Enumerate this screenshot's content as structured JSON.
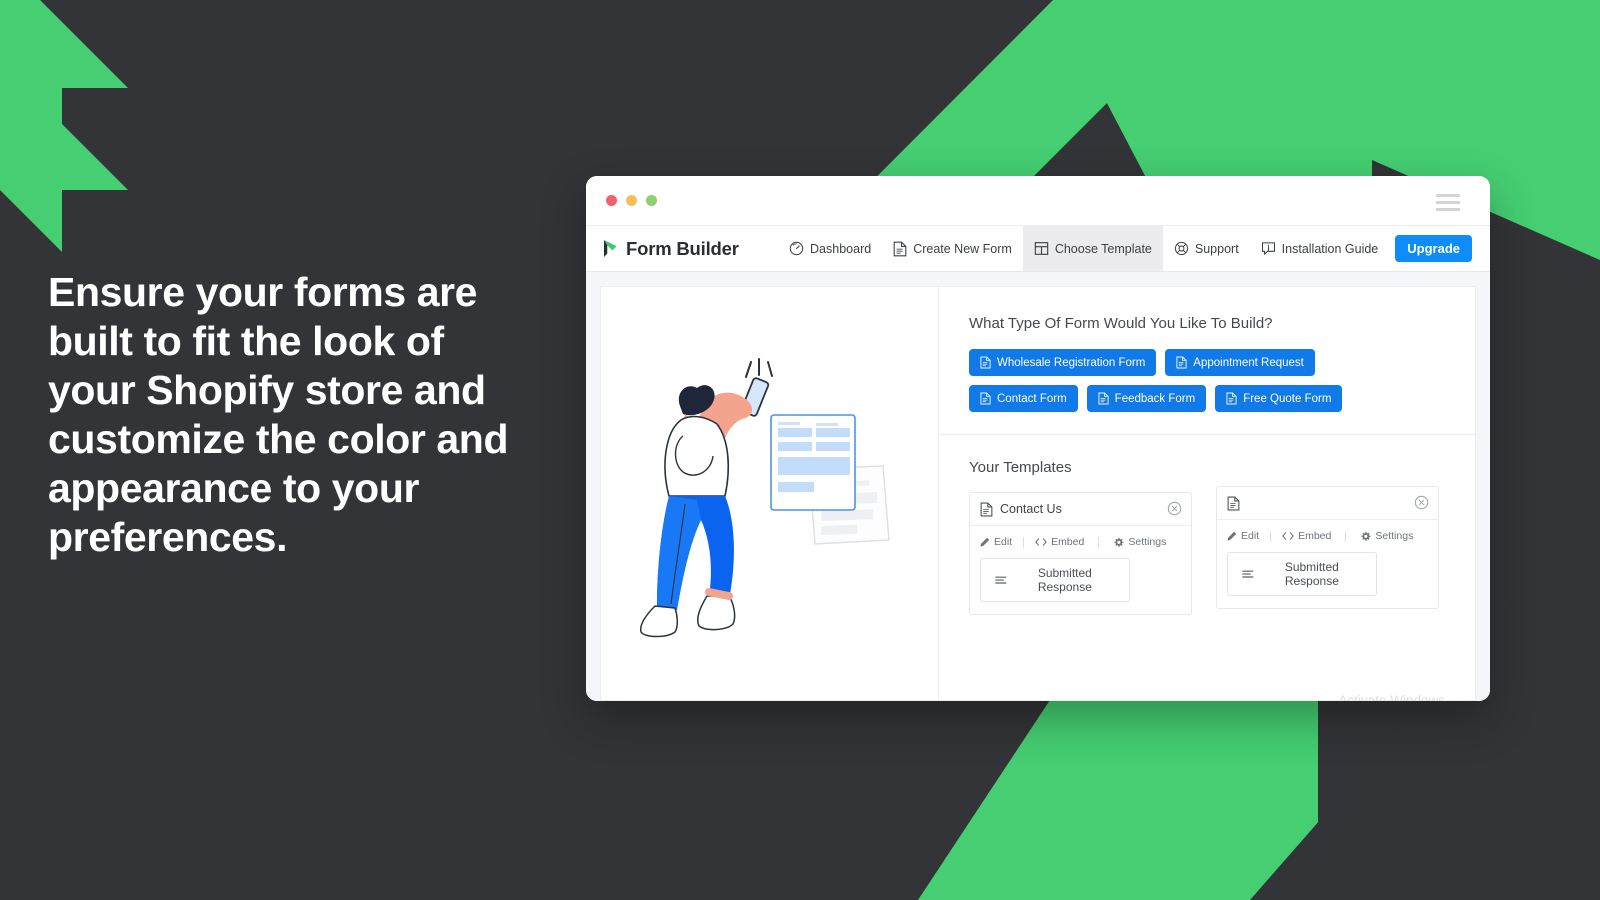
{
  "theme": {
    "background": "#333437",
    "accent_green": "#45CE72",
    "accent_blue": "#127AE8",
    "upgrade_blue": "#0E8CF7"
  },
  "headline": {
    "text": "Ensure your forms are built to fit the look of your Shopify store and customize the color and appearance to your preferences."
  },
  "browser": {
    "traffic_lights": [
      "close",
      "minimize",
      "maximize"
    ],
    "menu_icon": "hamburger-icon"
  },
  "app": {
    "brand": {
      "name": "Form Builder",
      "mark": "leaf-arrow-logo"
    },
    "nav": [
      {
        "label": "Dashboard",
        "icon": "speedometer-icon",
        "active": false
      },
      {
        "label": "Create New Form",
        "icon": "document-icon",
        "active": false
      },
      {
        "label": "Choose Template",
        "icon": "layout-icon",
        "active": true
      },
      {
        "label": "Support",
        "icon": "lifebuoy-icon",
        "active": false
      },
      {
        "label": "Installation Guide",
        "icon": "info-bubble-icon",
        "active": false
      }
    ],
    "upgrade_button": "Upgrade"
  },
  "illustration": {
    "name": "person-holding-phone-with-forms-illustration"
  },
  "form_types": {
    "heading": "What Type Of Form Would You Like To Build?",
    "options": [
      {
        "label": "Wholesale Registration Form",
        "icon": "document-icon"
      },
      {
        "label": "Appointment Request",
        "icon": "document-icon"
      },
      {
        "label": "Contact Form",
        "icon": "document-icon"
      },
      {
        "label": "Feedback Form",
        "icon": "document-icon"
      },
      {
        "label": "Free Quote Form",
        "icon": "document-icon"
      }
    ]
  },
  "templates": {
    "heading": "Your Templates",
    "action_labels": {
      "edit": "Edit",
      "embed": "Embed",
      "settings": "Settings"
    },
    "response_button": "Submitted Response",
    "items": [
      {
        "title": "Contact Us",
        "icon": "document-icon",
        "close": "close-circle-icon"
      },
      {
        "title": "",
        "icon": "document-icon",
        "close": "close-circle-icon"
      }
    ]
  },
  "watermark": {
    "text": "Activate Windows"
  }
}
